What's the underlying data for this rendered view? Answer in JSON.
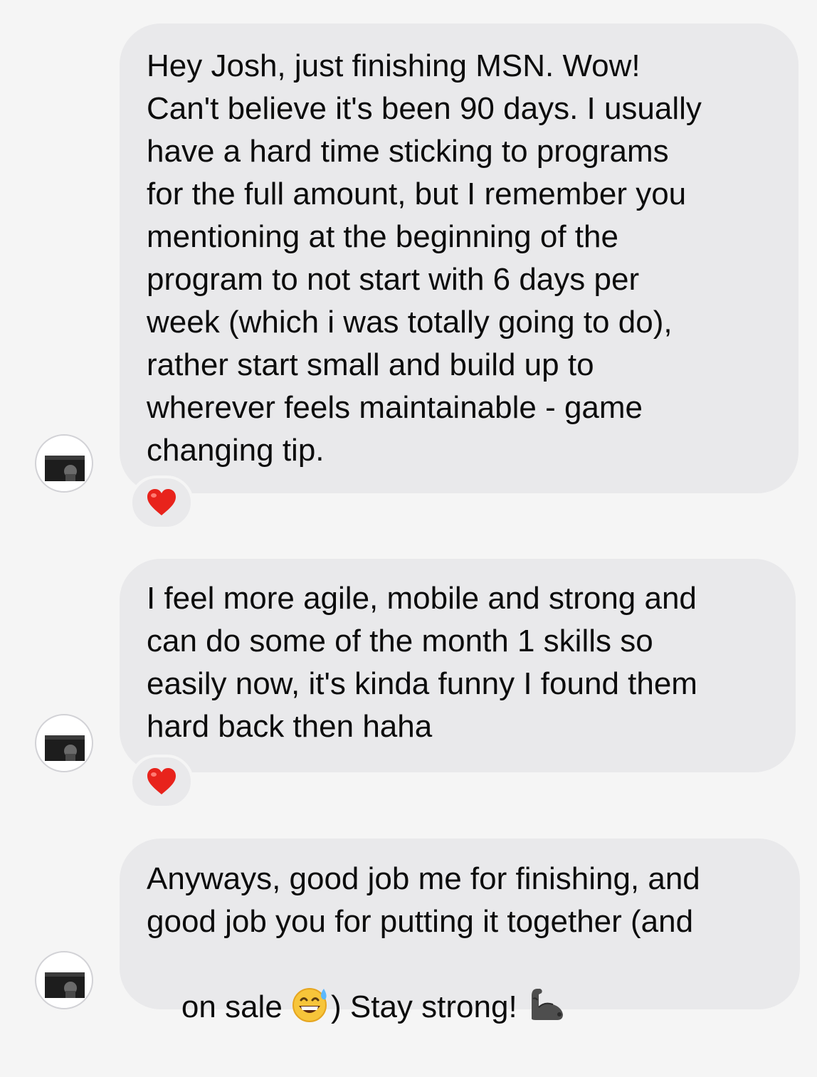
{
  "messages": [
    {
      "text": "Hey Josh, just finishing MSN. Wow!\nCan't believe it's been 90 days. I usually\nhave a hard time sticking to programs\nfor the full amount, but I remember you\nmentioning at the beginning of the\nprogram to not start with 6 days per\nweek (which i was totally going to do),\nrather start small and build up to\nwherever feels maintainable - game\nchanging tip.",
      "reaction": "heart-reaction"
    },
    {
      "text": "I feel more agile, mobile and strong and\ncan do some of the month 1 skills so\neasily now, it's kinda funny I found them\nhard back then haha",
      "reaction": "heart-reaction"
    },
    {
      "line1": "Anyways, good job me for finishing, and",
      "line2": "good job you for putting it together (and",
      "line3_before": "on sale ",
      "line3_middle": ") Stay strong! ",
      "inline_icons": [
        "grinning-sweat-emoji",
        "flexed-biceps-emoji"
      ]
    }
  ],
  "colors": {
    "background": "#f5f5f5",
    "bubble": "#e9e9eb",
    "text": "#0c0c0c",
    "heart": "#e8231c"
  }
}
